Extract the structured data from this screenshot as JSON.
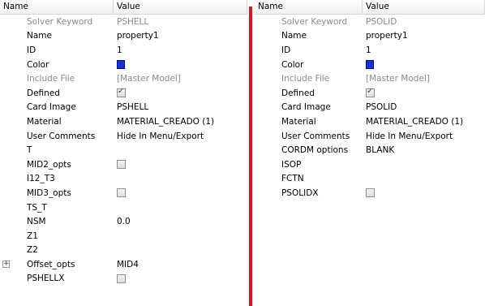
{
  "left": {
    "headers": {
      "name": "Name",
      "value": "Value"
    },
    "rows": [
      {
        "name": "Solver Keyword",
        "value": "PSHELL",
        "gray": true
      },
      {
        "name": "Name",
        "value": "property1"
      },
      {
        "name": "ID",
        "value": "1"
      },
      {
        "name": "Color",
        "value": ""
      },
      {
        "name": "Include File",
        "value": "[Master Model]",
        "gray": true
      },
      {
        "name": "Defined",
        "value": ""
      },
      {
        "name": "Card Image",
        "value": "PSHELL"
      },
      {
        "name": "Material",
        "value": "MATERIAL_CREADO (1)"
      },
      {
        "name": "User Comments",
        "value": "Hide In Menu/Export"
      },
      {
        "name": "T",
        "value": ""
      },
      {
        "name": "MID2_opts",
        "value": ""
      },
      {
        "name": "I12_T3",
        "value": ""
      },
      {
        "name": "MID3_opts",
        "value": ""
      },
      {
        "name": "TS_T",
        "value": ""
      },
      {
        "name": "NSM",
        "value": "0.0"
      },
      {
        "name": "Z1",
        "value": ""
      },
      {
        "name": "Z2",
        "value": ""
      },
      {
        "name": "Offset_opts",
        "value": "MID4"
      },
      {
        "name": "PSHELLX",
        "value": ""
      }
    ]
  },
  "right": {
    "headers": {
      "name": "Name",
      "value": "Value"
    },
    "rows": [
      {
        "name": "Solver Keyword",
        "value": "PSOLID",
        "gray": true
      },
      {
        "name": "Name",
        "value": "property1"
      },
      {
        "name": "ID",
        "value": "1"
      },
      {
        "name": "Color",
        "value": ""
      },
      {
        "name": "Include File",
        "value": "[Master Model]",
        "gray": true
      },
      {
        "name": "Defined",
        "value": ""
      },
      {
        "name": "Card Image",
        "value": "PSOLID"
      },
      {
        "name": "Material",
        "value": "MATERIAL_CREADO (1)"
      },
      {
        "name": "User Comments",
        "value": "Hide In Menu/Export"
      },
      {
        "name": "CORDM options",
        "value": "BLANK"
      },
      {
        "name": "ISOP",
        "value": ""
      },
      {
        "name": "FCTN",
        "value": ""
      },
      {
        "name": "PSOLIDX",
        "value": ""
      }
    ]
  },
  "colors": {
    "swatch": "#1230d8",
    "divider": "#e0141c"
  },
  "icons": {
    "expand": "plus-expand-icon",
    "checkbox": "checkbox-icon",
    "color": "color-swatch-icon"
  }
}
